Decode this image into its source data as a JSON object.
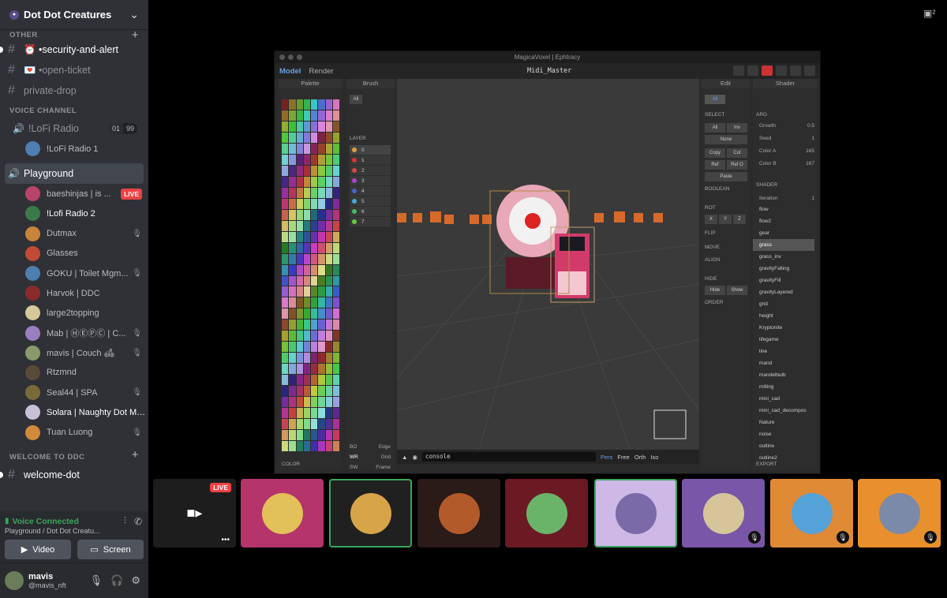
{
  "server": {
    "name": "Dot Dot Creatures"
  },
  "channels_top": [
    {
      "label": "OTHER"
    },
    {
      "label": "⏰ •security-and-alert",
      "unread": true
    },
    {
      "label": "💌 •open-ticket",
      "unread": false
    },
    {
      "label": "private-drop",
      "unread": false
    }
  ],
  "voice_category": "VOICE CHANNEL",
  "lofi": {
    "name": "!LoFi Radio",
    "count_a": "01",
    "count_b": "99",
    "member": "!LoFi Radio 1"
  },
  "playground": {
    "name": "Playground"
  },
  "members": [
    {
      "name": "baeshinjas | is ...",
      "live": "LIVE",
      "color": "#b9446a"
    },
    {
      "name": "!Lofi Radio 2",
      "color": "#3a7a4a"
    },
    {
      "name": "Dutmax",
      "color": "#c8843a"
    },
    {
      "name": "Glasses",
      "color": "#c24b36"
    },
    {
      "name": "GOKU | Toilet Mgm...",
      "color": "#4d7fb0"
    },
    {
      "name": "Harvok | DDC",
      "color": "#8a2b2b"
    },
    {
      "name": "large2topping",
      "color": "#d6c89a"
    },
    {
      "name": "Mab | ⒽⒺⓅⒸ | C...",
      "color": "#9a7fc0"
    },
    {
      "name": "mavis | Couch 🛋",
      "color": "#8a9a6a"
    },
    {
      "name": "Rtzmnd",
      "color": "#5a4a3a"
    },
    {
      "name": "Seal44 | SPA",
      "color": "#7a6a3a"
    },
    {
      "name": "Solara | Naughty Dot Mg...",
      "color": "#c9c0d8"
    },
    {
      "name": "Tuan Luong",
      "color": "#d08a3a"
    }
  ],
  "welcome_category": "WELCOME TO DDC",
  "welcome_channel": "welcome-dot",
  "voice_panel": {
    "status": "Voice Connected",
    "sub": "Playground / Dot Dot Creatu...",
    "video": "Video",
    "screen": "Screen"
  },
  "user": {
    "name": "mavis",
    "tag": "@mavis_nft"
  },
  "mv": {
    "title": "MagicaVoxel | Ephtracy",
    "tab_model": "Model",
    "tab_render": "Render",
    "file": "Midi_Master",
    "palette": "Palette",
    "brush": "Brush",
    "edit": "Edit",
    "shader": "Shader",
    "console": "console",
    "view_modes": [
      "Pers",
      "Free",
      "Orth",
      "Iso"
    ],
    "shader_list": [
      "flow",
      "flow2",
      "gear",
      "grass",
      "grass_inv",
      "gravityFalling",
      "gravityFill",
      "gravityLayered",
      "grid",
      "height",
      "Kryptonite",
      "lifegame",
      "line",
      "mand",
      "mandelbulb",
      "milling",
      "mini_cad",
      "mini_cad_decompos",
      "Nature",
      "noise",
      "outline",
      "outline2"
    ],
    "shader_selected": "grass",
    "layers": [
      "0",
      "1",
      "2",
      "3",
      "4",
      "5",
      "6",
      "7"
    ],
    "edit_labels": {
      "select": "SELECT",
      "all": "All",
      "inv": "Inv",
      "none": "None",
      "copy": "Copy",
      "cut": "Cut",
      "ref": "Ref",
      "refo": "Ref O",
      "paste": "Paste",
      "boolean": "BOOLEAN",
      "rot": "ROT",
      "flip": "FLIP",
      "move": "MOVE",
      "align": "ALIGN",
      "hide": "HIDE",
      "hide_btn": "Hide",
      "show": "Show",
      "order": "ORDER",
      "x": "X",
      "y": "Y",
      "z": "Z"
    },
    "arg": {
      "label": "ARG",
      "growth": "Growth",
      "growth_v": "0.5",
      "seed": "Seed",
      "seed_v": "1",
      "colora": "Color A",
      "colora_v": "165",
      "colorb": "Color B",
      "colorb_v": "167",
      "shader_lbl": "SHADER",
      "iteration": "Iteration",
      "iteration_v": "1"
    },
    "brush_labels": {
      "all": "All",
      "layer": "LAYER",
      "bo": "BO",
      "edge": "Edge",
      "wr": "WR",
      "grid": "Grid",
      "sw": "SW",
      "frame": "Frame",
      "color": "COLOR",
      "export": "EXPORT"
    }
  },
  "tiles": [
    {
      "name": "stream",
      "live": "LIVE",
      "bg": "#1d1d1d"
    },
    {
      "name": "tile-2",
      "bg": "#b5346b"
    },
    {
      "name": "tile-3",
      "bg": "#202020"
    },
    {
      "name": "tile-4",
      "bg": "#2a1a18"
    },
    {
      "name": "tile-5",
      "bg": "#6b1a24"
    },
    {
      "name": "tile-6",
      "bg": "#cdb8e6"
    },
    {
      "name": "tile-7",
      "bg": "#7a56a8"
    },
    {
      "name": "tile-8",
      "bg": "#e08a36"
    },
    {
      "name": "tile-9",
      "bg": "#e8902e"
    }
  ],
  "colors": {
    "accent_green": "#3ba55d",
    "live_red": "#ed4245",
    "sidebar": "#2f3136"
  }
}
